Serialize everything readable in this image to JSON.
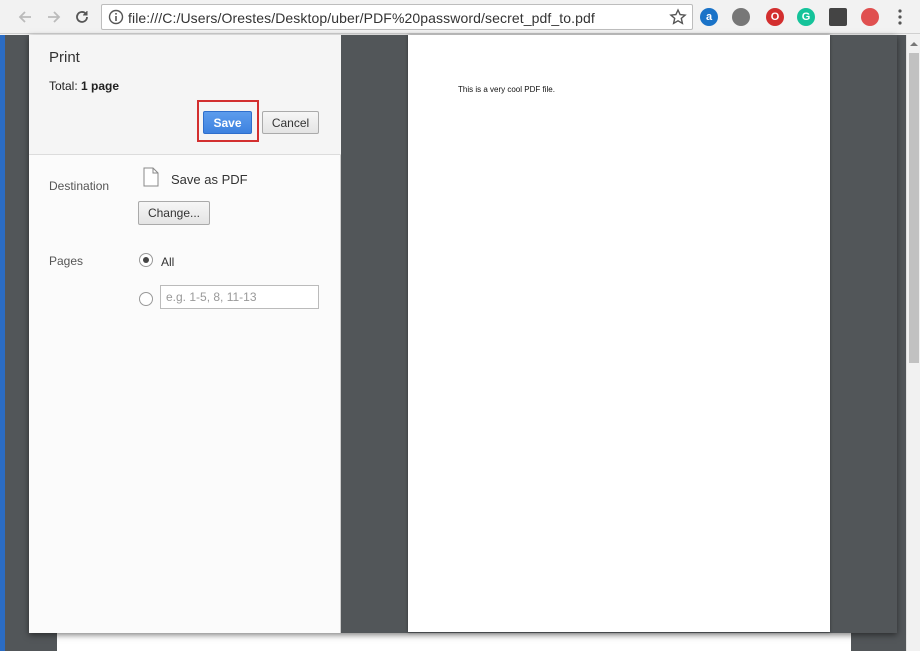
{
  "browser": {
    "url": "file:///C:/Users/Orestes/Desktop/uber/PDF%20password/secret_pdf_to.pdf",
    "extensions": [
      {
        "name": "a-icon",
        "letter": "a",
        "color": "#1a73c8"
      },
      {
        "name": "gear-extension-icon",
        "letter": "",
        "color": "#777777"
      },
      {
        "name": "opera-icon",
        "letter": "O",
        "color": "#d32f2f"
      },
      {
        "name": "grammarly-icon",
        "letter": "G",
        "color": "#15c39a"
      },
      {
        "name": "download-icon",
        "letter": "",
        "color": "#444444"
      },
      {
        "name": "shield-extension-icon",
        "letter": "",
        "color": "#e05050"
      }
    ]
  },
  "print": {
    "title": "Print",
    "total_label": "Total:",
    "total_value": "1 page",
    "save_label": "Save",
    "cancel_label": "Cancel",
    "destination_label": "Destination",
    "destination_value": "Save as PDF",
    "change_label": "Change...",
    "pages_label": "Pages",
    "pages_all_label": "All",
    "pages_custom_placeholder": "e.g. 1-5, 8, 11-13",
    "pages_selected": "all"
  },
  "preview": {
    "document_text": "This is a very cool PDF file."
  },
  "colors": {
    "save_highlight": "#d32f2f",
    "save_button": "#4a8fe7",
    "preview_background": "#525659"
  }
}
